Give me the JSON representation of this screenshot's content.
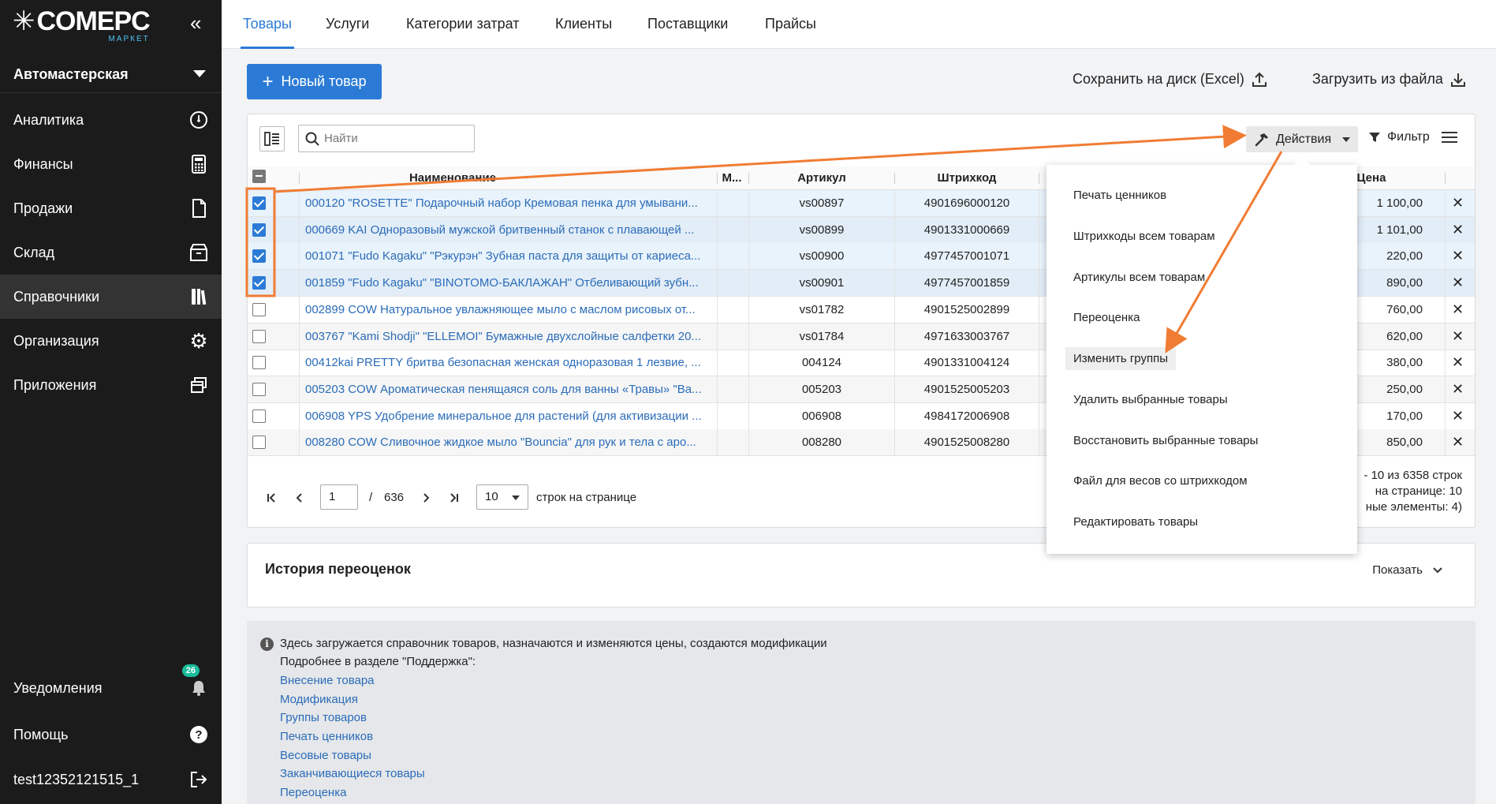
{
  "app": {
    "logo_main": "COMEPC",
    "logo_sub": "МАРКЕТ"
  },
  "sidebar": {
    "org": "Автомастерская",
    "items": [
      {
        "label": "Аналитика",
        "icon": "gauge-icon"
      },
      {
        "label": "Финансы",
        "icon": "calculator-icon"
      },
      {
        "label": "Продажи",
        "icon": "document-icon"
      },
      {
        "label": "Склад",
        "icon": "box-icon"
      },
      {
        "label": "Справочники",
        "icon": "book-icon"
      },
      {
        "label": "Организация",
        "icon": "gear-icon"
      },
      {
        "label": "Приложения",
        "icon": "windows-icon"
      }
    ],
    "notifications": "Уведомления",
    "notifications_count": "26",
    "help": "Помощь",
    "user": "test12352121515_1"
  },
  "tabs": [
    "Товары",
    "Услуги",
    "Категории затрат",
    "Клиенты",
    "Поставщики",
    "Прайсы"
  ],
  "toolbar": {
    "new_product": "Новый товар",
    "save_excel": "Сохранить на диск (Excel)",
    "load_file": "Загрузить из файла"
  },
  "table_toolbar": {
    "search_placeholder": "Найти",
    "actions": "Действия",
    "filter": "Фильтр"
  },
  "table": {
    "headers": {
      "name": "Наименование",
      "m": "М...",
      "article": "Артикул",
      "barcode": "Штрихкод",
      "price": "Цена"
    },
    "rows": [
      {
        "name": "000120 \"ROSETTE\" Подарочный набор Кремовая пенка для умывани...",
        "article": "vs00897",
        "barcode": "4901696000120",
        "price": "1 100,00",
        "checked": true
      },
      {
        "name": "000669 KAI Одноразовый мужской бритвенный станок с плавающей ...",
        "article": "vs00899",
        "barcode": "4901331000669",
        "price": "1 101,00",
        "checked": true
      },
      {
        "name": "001071 \"Fudo Kagaku\" \"Рэкурэн\" Зубная паста для защиты от кариеса...",
        "article": "vs00900",
        "barcode": "4977457001071",
        "price": "220,00",
        "checked": true
      },
      {
        "name": "001859 \"Fudo Kagaku\" \"BINOTOMO-БАКЛАЖАН\" Отбеливающий зубн...",
        "article": "vs00901",
        "barcode": "4977457001859",
        "price": "890,00",
        "checked": true
      },
      {
        "name": "002899 COW Натуральное увлажняющее мыло с маслом рисовых от...",
        "article": "vs01782",
        "barcode": "4901525002899",
        "price": "760,00",
        "checked": false
      },
      {
        "name": "003767 \"Kami Shodji\" \"ELLEMOI\" Бумажные двухслойные салфетки 20...",
        "article": "vs01784",
        "barcode": "4971633003767",
        "price": "620,00",
        "checked": false
      },
      {
        "name": "00412kai PRETTY бритва безопасная женская одноразовая 1 лезвие, ...",
        "article": "004124",
        "barcode": "4901331004124",
        "price": "380,00",
        "checked": false
      },
      {
        "name": "005203 COW Ароматическая пенящаяся соль для ванны «Травы» \"Ва...",
        "article": "005203",
        "barcode": "4901525005203",
        "price": "250,00",
        "checked": false
      },
      {
        "name": "006908 YPS Удобрение минеральное для растений (для активизации ...",
        "article": "006908",
        "barcode": "4984172006908",
        "price": "170,00",
        "checked": false
      },
      {
        "name": "008280 COW Сливочное жидкое мыло \"Bouncia\" для рук и тела с аро...",
        "article": "008280",
        "barcode": "4901525008280",
        "price": "850,00",
        "checked": false
      }
    ]
  },
  "pagination": {
    "page": "1",
    "separator": "/",
    "total_pages": "636",
    "per_page": "10",
    "per_page_label": "строк на странице",
    "info_1": "- 10 из 6358 строк",
    "info_2": "на странице: 10",
    "info_3": "ные элементы: 4)"
  },
  "history": {
    "title": "История переоценок",
    "show": "Показать"
  },
  "info": {
    "line1": "Здесь загружается справочник товаров, назначаются и изменяются цены, создаются модификации",
    "line2": "Подробнее в разделе \"Поддержка\":",
    "links": [
      "Внесение товара",
      "Модификация",
      "Группы товаров",
      "Печать ценников",
      "Весовые товары",
      "Заканчивающиеся товары",
      "Переоценка"
    ]
  },
  "actions_menu": {
    "items": [
      "Печать ценников",
      "Штрихкоды всем товарам",
      "Артикулы всем товарам",
      "Переоценка",
      "Изменить группы",
      "Удалить выбранные товары",
      "Восстановить выбранные товары",
      "Файл для весов со штрихкодом",
      "Редактировать товары"
    ],
    "highlighted_index": 4
  },
  "colors": {
    "accent": "#2b7bd6",
    "annotation": "#f07c33",
    "sidebar_bg": "#1b1b1b",
    "badge": "#1abc9c"
  }
}
